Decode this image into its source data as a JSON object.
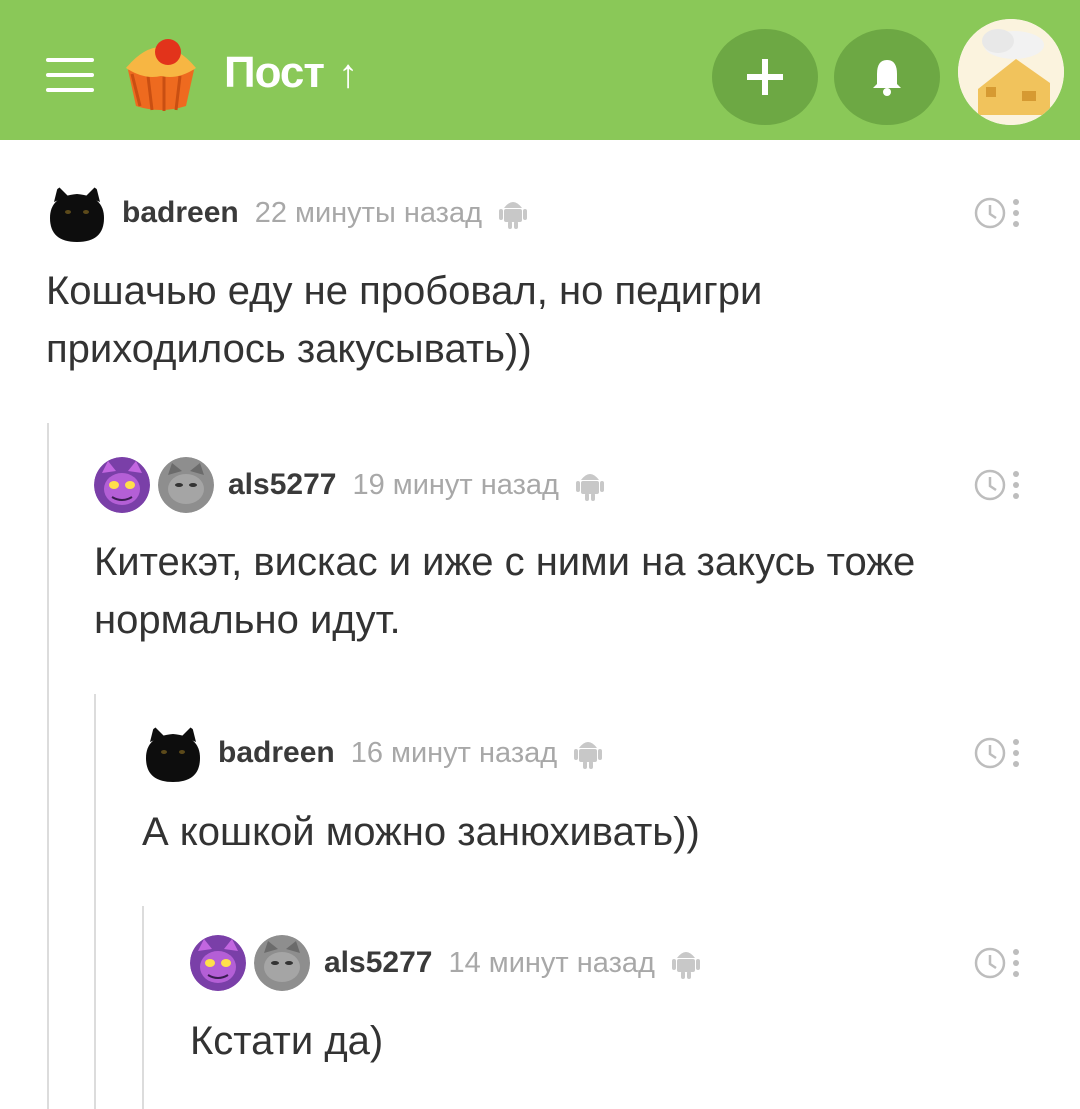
{
  "topbar": {
    "title": "Пост",
    "arrow": "↑",
    "add_label": "+"
  },
  "comments": [
    {
      "username": "badreen",
      "time": "22 минуты назад",
      "text_lines": [
        "Кошачью еду не пробовал, но педигри",
        "приходилось закусывать))"
      ]
    },
    {
      "username": "als5277",
      "time": "19 минут назад",
      "text_lines": [
        "Китекэт, вискас и иже с ними на закусь тоже",
        "нормально идут."
      ]
    },
    {
      "username": "badreen",
      "time": "16 минут назад",
      "text_lines": [
        "А кошкой можно занюхивать))"
      ]
    },
    {
      "username": "als5277",
      "time": "14 минут назад",
      "text_lines": [
        "Кстати да)"
      ]
    }
  ],
  "icons": {
    "menu": "hamburger-icon",
    "logo": "cupcake-logo-icon",
    "add": "plus-icon",
    "notifications": "bell-icon",
    "platform": "android-icon",
    "save": "clock-icon",
    "more": "more-vertical-icon"
  },
  "colors": {
    "topbar": "#8ac858",
    "topbar_button": "#6da844",
    "username": "#3a3a3a",
    "timestamp": "#a8a8a8",
    "text": "#333333"
  }
}
